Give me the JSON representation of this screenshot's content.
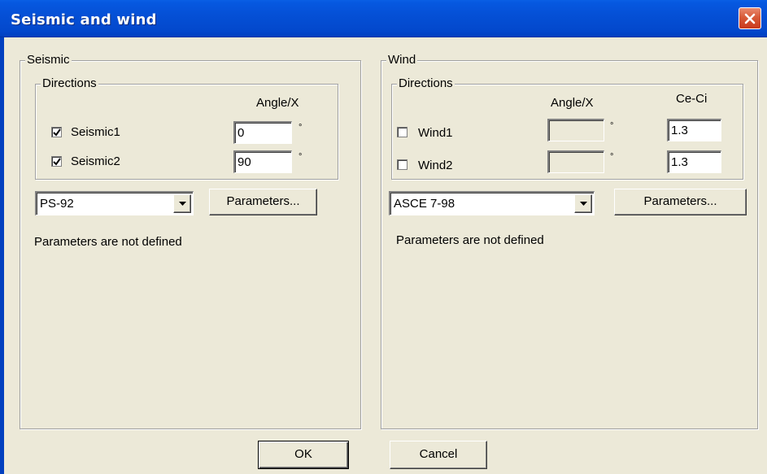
{
  "window": {
    "title": "Seismic and wind"
  },
  "seismic": {
    "group_label": "Seismic",
    "directions_label": "Directions",
    "angle_header": "Angle/X",
    "degree_symbol": "°",
    "items": [
      {
        "label": "Seismic1",
        "checked": true,
        "angle": "0"
      },
      {
        "label": "Seismic2",
        "checked": true,
        "angle": "90"
      }
    ],
    "code_selected": "PS-92",
    "parameters_button": "Parameters...",
    "status": "Parameters are not defined"
  },
  "wind": {
    "group_label": "Wind",
    "directions_label": "Directions",
    "angle_header": "Angle/X",
    "ceci_header": "Ce-Ci",
    "degree_symbol": "°",
    "items": [
      {
        "label": "Wind1",
        "checked": false,
        "angle": "",
        "ceci": "1.3"
      },
      {
        "label": "Wind2",
        "checked": false,
        "angle": "",
        "ceci": "1.3"
      }
    ],
    "code_selected": "ASCE 7-98",
    "parameters_button": "Parameters...",
    "status": "Parameters are not defined"
  },
  "footer": {
    "ok_label": "OK",
    "cancel_label": "Cancel"
  },
  "colors": {
    "dialog_bg": "#ECE9D8",
    "titlebar": "#0550D6",
    "close_button": "#D85A39"
  }
}
